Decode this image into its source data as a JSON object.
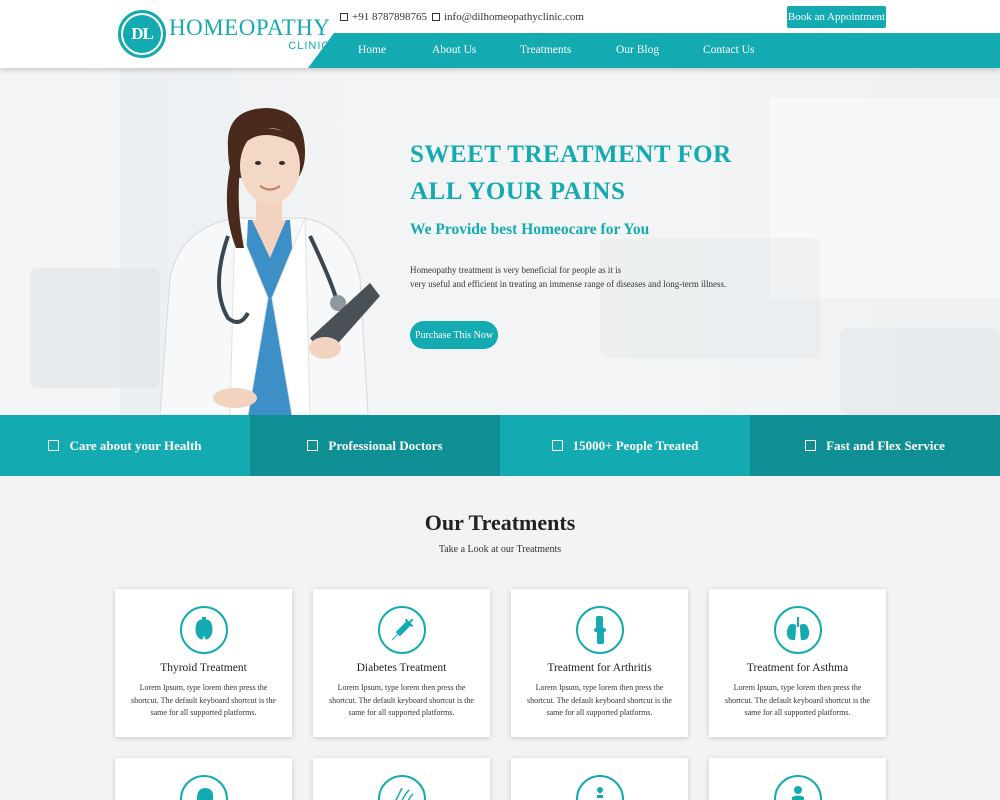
{
  "header": {
    "logo": {
      "monogram": "DL",
      "title": "HOMEOPATHY",
      "subtitle": "CLINIC"
    },
    "phone": "+91 8787898765",
    "email": "info@dilhomeopathyclinic.com",
    "book_button": "Book an Appointment",
    "nav": [
      "Home",
      "About Us",
      "Treatments",
      "Our Blog",
      "Contact Us"
    ]
  },
  "hero": {
    "title_line1": "SWEET TREATMENT FOR",
    "title_line2": "ALL YOUR PAINS",
    "subtitle": "We Provide best Homeocare for You",
    "desc_line1": "Homeopathy treatment is very beneficial for people as it is",
    "desc_line2": "very useful and efficient in treating an immense range of diseases and long-term illness.",
    "button": "Purchase This Now"
  },
  "features": [
    {
      "label": "Care about your Health",
      "color": "#14aab1"
    },
    {
      "label": "Professional Doctors",
      "color": "#0f8f94"
    },
    {
      "label": "15000+ People Treated",
      "color": "#14aab1"
    },
    {
      "label": "Fast and Flex Service",
      "color": "#0f8f94"
    }
  ],
  "treatments": {
    "title": "Our Treatments",
    "subtitle": "Take a Look at our Treatments",
    "cards": [
      {
        "icon": "thyroid-icon",
        "title": "Thyroid Treatment",
        "text": "Lorem Ipsum, type lorem then press the shortcut. The default keyboard shortcut is the same for all supported platforms."
      },
      {
        "icon": "syringe-icon",
        "title": "Diabetes Treatment",
        "text": "Lorem Ipsum, type lorem then press the shortcut. The default keyboard shortcut is the same for all supported platforms."
      },
      {
        "icon": "knee-joint-icon",
        "title": "Treatment for Arthritis",
        "text": "Lorem Ipsum, type lorem then press the shortcut. The default keyboard shortcut is the same for all supported platforms."
      },
      {
        "icon": "lungs-icon",
        "title": "Treatment for Asthma",
        "text": "Lorem Ipsum, type lorem then press the shortcut. The default keyboard shortcut is the same for all supported platforms."
      }
    ],
    "more_card_icons": [
      "head-profile-icon",
      "hair-icon",
      "spine-icon",
      "body-icon"
    ]
  },
  "colors": {
    "accent": "#14aab1",
    "accent_dark": "#0f8f94"
  }
}
